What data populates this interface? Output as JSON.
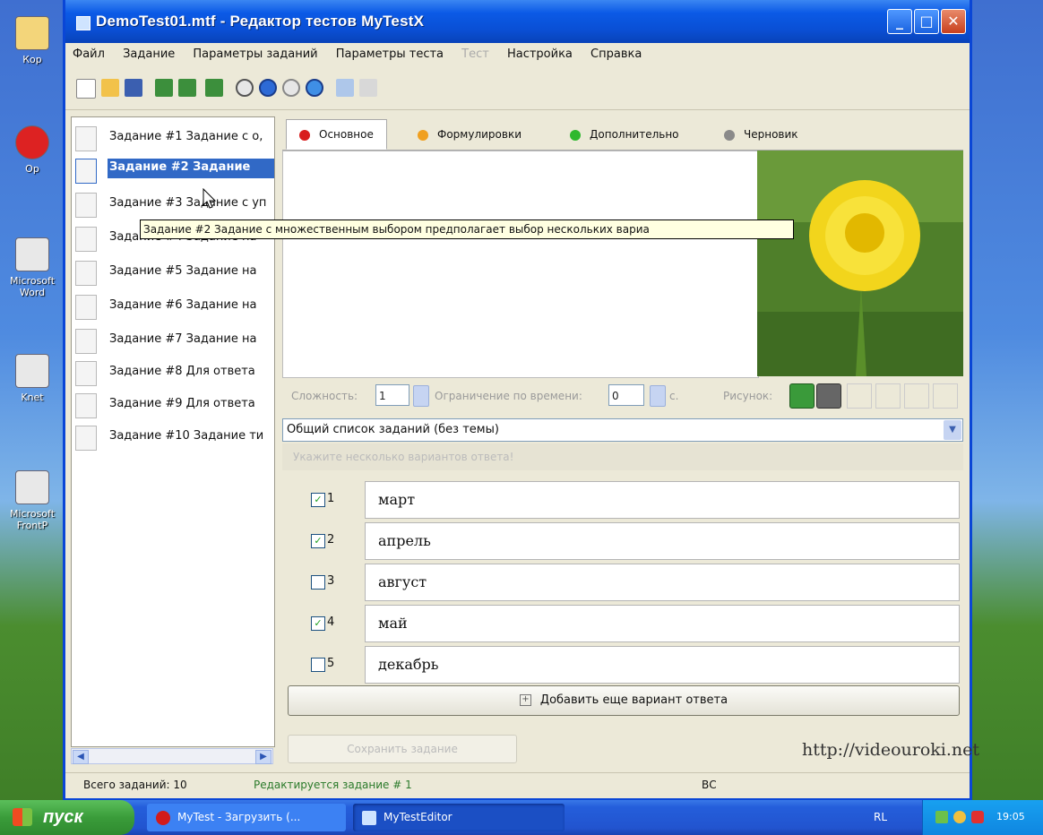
{
  "window": {
    "title": "DemoTest01.mtf - Редактор тестов MyTestX"
  },
  "menu": [
    "Файл",
    "Задание",
    "Параметры заданий",
    "Параметры теста",
    "Тест",
    "Настройка",
    "Справка"
  ],
  "tasks": [
    "Задание #1 Задание с о,",
    "Задание #2 Задание",
    "Задание #3 Задание с уп",
    "Задание #4 Задание на",
    "Задание #5 Задание на",
    "Задание #6 Задание на",
    "Задание #7 Задание на",
    "Задание #8 Для ответа",
    "Задание #9 Для ответа",
    "Задание #10 Задание ти"
  ],
  "selected_task_index": 1,
  "tooltip": "Задание #2 Задание с множественным выбором предполагает выбор нескольких вариа",
  "tabs": [
    {
      "label": "Основное",
      "color": "#d81c1c"
    },
    {
      "label": "Формулировки",
      "color": "#f0a020"
    },
    {
      "label": "Дополнительно",
      "color": "#2eb82e"
    },
    {
      "label": "Черновик",
      "color": "#8a8a8a"
    }
  ],
  "props": {
    "difficulty_label": "Сложность:",
    "difficulty_value": "1",
    "time_label": "Ограничение по времени:",
    "time_value": "0",
    "time_unit": "с.",
    "picture_label": "Рисунок:"
  },
  "topic_select": "Общий список заданий (без темы)",
  "hint": "Укажите несколько вариантов ответа!",
  "answers": [
    {
      "num": "1",
      "text": "март",
      "checked": true
    },
    {
      "num": "2",
      "text": "апрель",
      "checked": true
    },
    {
      "num": "3",
      "text": "август",
      "checked": false
    },
    {
      "num": "4",
      "text": "май",
      "checked": true
    },
    {
      "num": "5",
      "text": "декабрь",
      "checked": false
    }
  ],
  "add_answer_label": "Добавить еще вариант ответа",
  "save_label": "Сохранить задание",
  "watermark": "http://videouroki.net",
  "status": {
    "total": "Всего заданий: 10",
    "editing": "Редактируется задание # 1",
    "mode": "ВС"
  },
  "taskbar": {
    "start_label": "пуск",
    "buttons": [
      "MyTest - Загрузить (...",
      "MyTestEditor"
    ],
    "language": "RL",
    "clock": "19:05"
  },
  "desktop_icons": [
    "Кор",
    "Op",
    "Microsoft Word",
    "Knet",
    "Microsoft FrontP"
  ]
}
